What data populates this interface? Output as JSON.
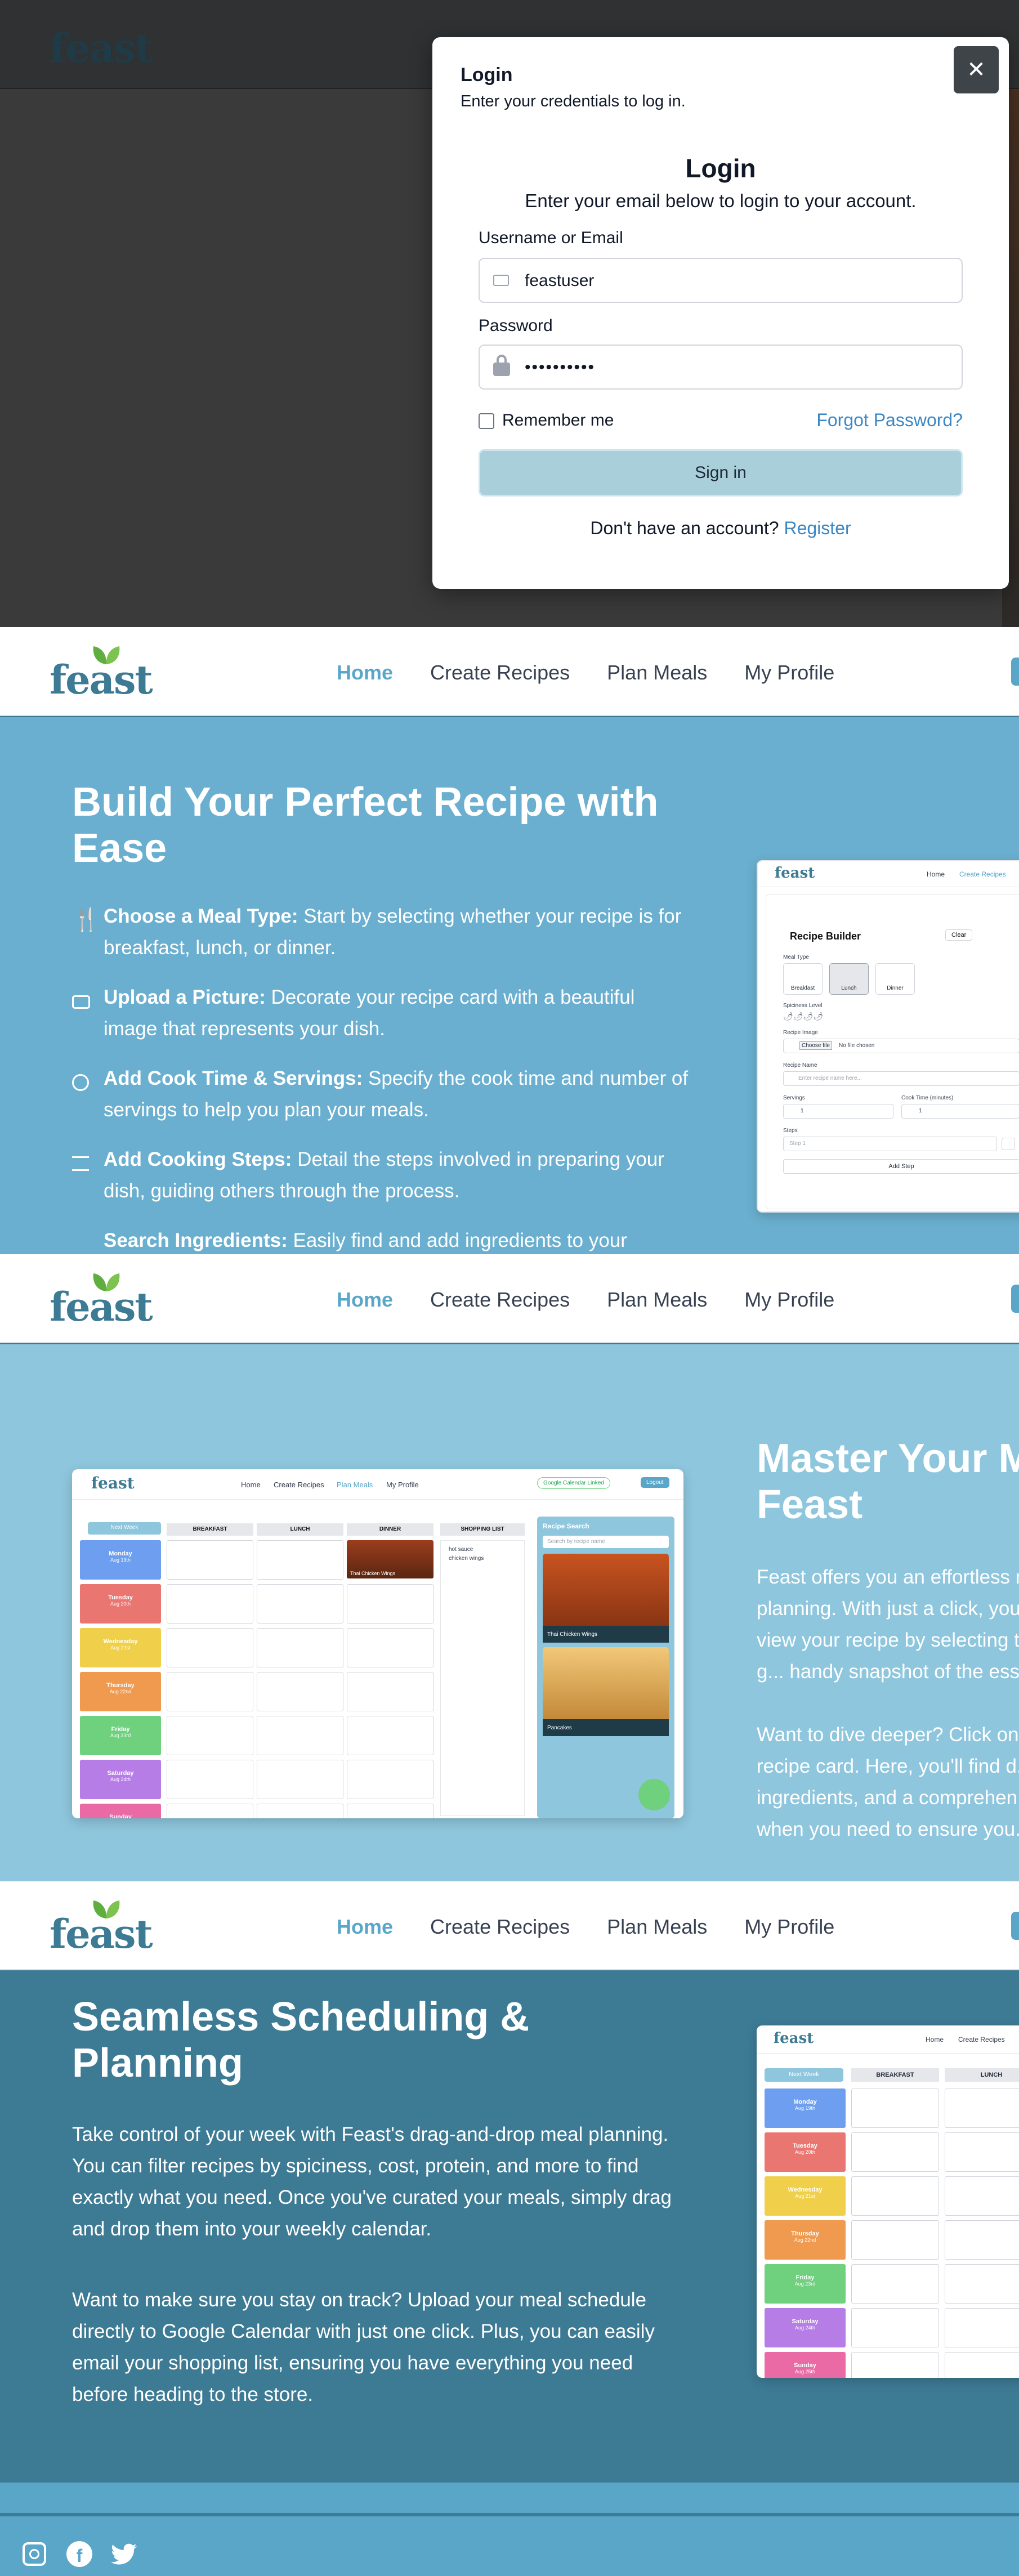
{
  "brand": {
    "logo_text": "feast"
  },
  "modal": {
    "header_title": "Login",
    "header_subtitle": "Enter your credentials to log in.",
    "close_label": "✕",
    "title": "Login",
    "subtitle": "Enter your email below to login to your account.",
    "username_label": "Username or Email",
    "username_value": "feastuser",
    "password_label": "Password",
    "password_value": "••••••••••",
    "remember_label": "Remember me",
    "forgot_label": "Forgot Password?",
    "signin_label": "Sign in",
    "no_account": "Don't have an account?",
    "register_label": "Register"
  },
  "nav": {
    "home": "Home",
    "create": "Create Recipes",
    "plan": "Plan Meals",
    "profile": "My Profile"
  },
  "section1": {
    "title": "Build Your Perfect Recipe with Ease",
    "items": [
      {
        "bold": "Choose a Meal Type:",
        "text": " Start by selecting whether your recipe is for breakfast, lunch, or dinner."
      },
      {
        "bold": "Upload a Picture:",
        "text": " Decorate your recipe card with a beautiful image that represents your dish."
      },
      {
        "bold": "Add Cook Time & Servings:",
        "text": " Specify the cook time and number of servings to help you plan your meals."
      },
      {
        "bold": "Add Cooking Steps:",
        "text": " Detail the steps involved in preparing your dish, guiding others through the process."
      },
      {
        "bold": "Search Ingredients:",
        "text": " Easily find and add ingredients to your"
      }
    ],
    "mock": {
      "nav_home": "Home",
      "nav_create": "Create Recipes",
      "title": "Recipe Builder",
      "clear": "Clear",
      "meal_type": "Meal Type",
      "breakfast": "Breakfast",
      "lunch": "Lunch",
      "dinner": "Dinner",
      "spiciness": "Spiciness Level",
      "image_label": "Recipe Image",
      "choose_file": "Choose file",
      "no_file": "No file chosen",
      "name_label": "Recipe Name",
      "name_placeholder": "Enter recipe name here...",
      "servings_label": "Servings",
      "servings_value": "1",
      "cook_label": "Cook Time (minutes)",
      "cook_value": "1",
      "steps_label": "Steps",
      "step_placeholder": "Step 1",
      "add_step": "Add Step"
    }
  },
  "section2": {
    "title": "Master Your Meal Feast",
    "para1": "Feast offers you an effortless meal planning. With just a click, you can view your recipe by selecting the g... handy snapshot of the essent...",
    "para2": "Want to dive deeper? Click on the recipe card. Here, you'll find d... ingredients, and a comprehen... when you need to ensure you...",
    "mock": {
      "nav_home": "Home",
      "nav_create": "Create Recipes",
      "nav_plan": "Plan Meals",
      "nav_profile": "My Profile",
      "gcal": "Google Calendar Linked",
      "logout": "Logout",
      "next_week": "Next Week",
      "cols": [
        "BREAKFAST",
        "LUNCH",
        "DINNER",
        "SHOPPING LIST"
      ],
      "days": [
        {
          "day": "Monday",
          "date": "Aug 19th",
          "color": "#6d9ef0"
        },
        {
          "day": "Tuesday",
          "date": "Aug 20th",
          "color": "#ea7671"
        },
        {
          "day": "Wednesday",
          "date": "Aug 21st",
          "color": "#f0cf4a"
        },
        {
          "day": "Thursday",
          "date": "Aug 22nd",
          "color": "#ef9a4f"
        },
        {
          "day": "Friday",
          "date": "Aug 23rd",
          "color": "#6fd07e"
        },
        {
          "day": "Saturday",
          "date": "Aug 24th",
          "color": "#b67de6"
        },
        {
          "day": "Sunday",
          "date": "Aug 25th",
          "color": "#ea6aa6"
        }
      ],
      "dinner_card": "Thai Chicken Wings",
      "shopping": [
        "hot sauce",
        "chicken wings"
      ],
      "search_title": "Recipe Search",
      "search_placeholder": "Search by recipe name",
      "result1": "Thai Chicken Wings",
      "result2": "Pancakes"
    }
  },
  "section3": {
    "title": "Seamless Scheduling & Planning",
    "para1": "Take control of your week with Feast's drag-and-drop meal planning. You can filter recipes by spiciness, cost, protein, and more to find exactly what you need. Once you've curated your meals, simply drag and drop them into your weekly calendar.",
    "para2": "Want to make sure you stay on track? Upload your meal schedule directly to Google Calendar with just one click. Plus, you can easily email your shopping list, ensuring you have everything you need before heading to the store.",
    "mock": {
      "nav_home": "Home",
      "nav_create": "Create Recipes",
      "next_week": "Next Week",
      "cols": [
        "BREAKFAST",
        "LUNCH"
      ]
    }
  },
  "footer": {
    "icons": [
      "instagram-icon",
      "facebook-icon",
      "twitter-icon"
    ]
  },
  "colors": {
    "primary": "#5aa6c9",
    "dark_teal": "#3d7a94",
    "section1_bg": "#6aafcf",
    "section2_bg": "#8ec6dd",
    "signin_bg": "#a9cfdb"
  }
}
